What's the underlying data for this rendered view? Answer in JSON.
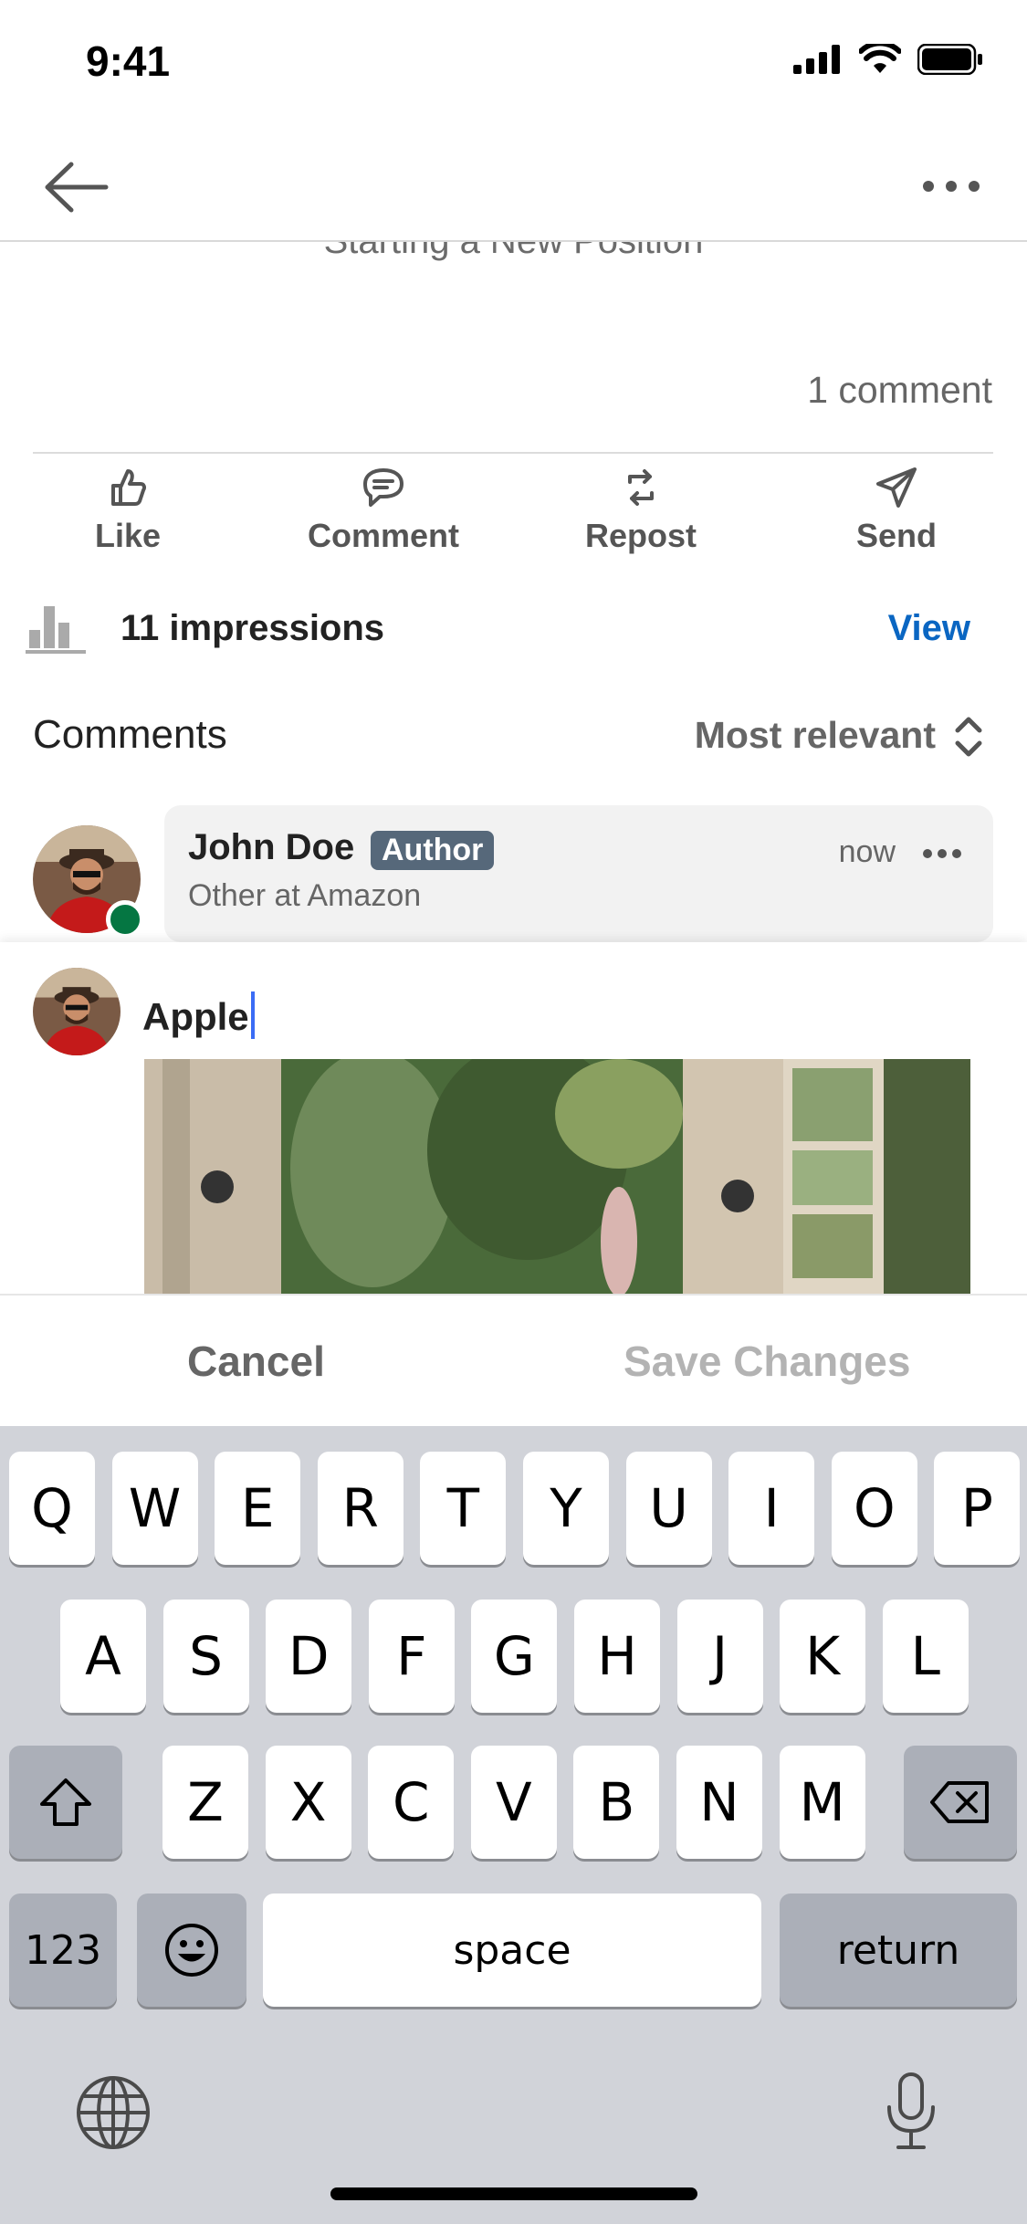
{
  "status_bar": {
    "time": "9:41"
  },
  "post": {
    "partial_title": "Starting a New Position",
    "comment_count": "1 comment",
    "actions": [
      {
        "label": "Like",
        "icon": "thumbs-up-icon"
      },
      {
        "label": "Comment",
        "icon": "comment-icon"
      },
      {
        "label": "Repost",
        "icon": "repost-icon"
      },
      {
        "label": "Send",
        "icon": "send-icon"
      }
    ],
    "impressions": {
      "text": "11 impressions",
      "view_label": "View"
    }
  },
  "comments": {
    "header": "Comments",
    "sort_label": "Most relevant",
    "items": [
      {
        "name": "John Doe",
        "badge": "Author",
        "subtitle": "Other at Amazon",
        "time": "now"
      }
    ]
  },
  "editor": {
    "text": "Apple",
    "cancel_label": "Cancel",
    "save_label": "Save Changes"
  },
  "keyboard": {
    "row1": [
      "Q",
      "W",
      "E",
      "R",
      "T",
      "Y",
      "U",
      "I",
      "O",
      "P"
    ],
    "row2": [
      "A",
      "S",
      "D",
      "F",
      "G",
      "H",
      "J",
      "K",
      "L"
    ],
    "row3": [
      "Z",
      "X",
      "C",
      "V",
      "B",
      "N",
      "M"
    ],
    "numbers_label": "123",
    "space_label": "space",
    "return_label": "return"
  },
  "colors": {
    "accent": "#0a66c2",
    "author_badge": "#56687a",
    "online": "#057642",
    "caret": "#3b6cf5"
  }
}
